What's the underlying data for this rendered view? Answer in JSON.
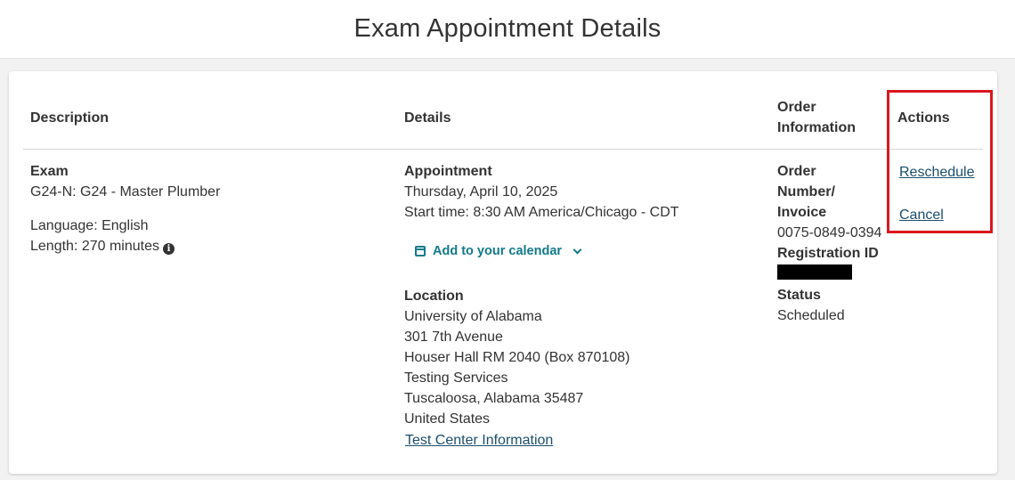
{
  "page": {
    "title": "Exam Appointment Details"
  },
  "table": {
    "headers": {
      "description": "Description",
      "details": "Details",
      "order_line1": "Order",
      "order_line2": "Information",
      "actions": "Actions"
    }
  },
  "description": {
    "exam_label": "Exam",
    "exam_name": "G24-N: G24 - Master Plumber",
    "language": "Language: English",
    "length": "Length: 270 minutes"
  },
  "details": {
    "appointment_label": "Appointment",
    "date": "Thursday, April 10, 2025",
    "start_time": "Start time: 8:30 AM America/Chicago - CDT",
    "calendar_label": "Add to your calendar",
    "location_label": "Location",
    "location_lines": [
      "University of Alabama",
      "301 7th Avenue",
      "Houser Hall RM 2040 (Box 870108)",
      "Testing Services",
      "Tuscaloosa, Alabama 35487",
      "United States"
    ],
    "test_center_link": "Test Center Information"
  },
  "order": {
    "order_label_line1": "Order",
    "order_label_line2": "Number/",
    "order_label_line3": "Invoice",
    "order_number": "0075-0849-0394",
    "registration_label": "Registration ID",
    "status_label": "Status",
    "status_value": "Scheduled"
  },
  "actions": {
    "reschedule": "Reschedule",
    "cancel": "Cancel"
  },
  "colors": {
    "link": "#1a4f6e",
    "accent": "#117a8b",
    "highlight": "#d9171e"
  },
  "icons": {
    "info": "info-icon",
    "calendar": "calendar-icon",
    "chevron": "chevron-down-icon"
  }
}
